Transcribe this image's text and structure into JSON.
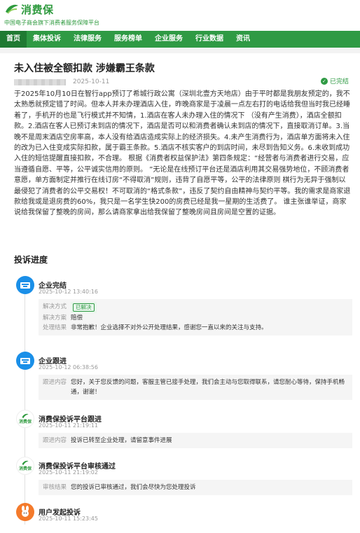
{
  "header": {
    "brand": "消费保",
    "tagline": "中国电子商会旗下消费者服务保障平台"
  },
  "nav": {
    "items": [
      "首页",
      "集体投诉",
      "法律服务",
      "服务榜单",
      "企业服务",
      "行业数据",
      "资讯"
    ]
  },
  "article": {
    "title": "未入住被全额扣款 涉嫌霸王条款",
    "date": "2025-10-11",
    "status": "已完结",
    "body": "于2025年10月10日在智行app预订了希城行政公寓（深圳北壹方天地店）由于平时都是我朋友预定的，我不太熟悉就预定错了时间。但本人并未办理酒店入住，昨晚商家是于凌晨一点左右打的电话给我但当时我已经睡着了，手机开的也是飞行模式并不知情，1.酒店在客人未办理入住的情况下 （没有产生消费），酒店全额扣款。2.酒店在客人已预订未到店的情况下，酒店是否可以和消费者确认未到店的情况下，直接取消订单。3.当晚不是周末酒店空房率高，本人没有给酒店造成实际上的经济损失。4.未产生消费行为，酒店单方面将未入住的改为已入住变成实际扣款，属于霸王条款。5.酒店不核实客户的到店时间，未尽到告知义务。6.未收到成功入住的短信提醒直接扣款，不合理。 根据《消费者权益保护法》第四条规定：“经营者与消费者进行交易，应当遵循自愿、平等，公平诚实信用的原则。 ”无论是在线预订平台还是酒店利用其交易强势地位，不顾消费者意愿，单方面制定并推行在线订房“不得取消”规则，违背了自愿平等，公平的法律原则 棋行为无异于强制以最侵犯了消费者的公平交易权！不可取消的“格式条款”，违反了契约自由精神与契约平等。我的需求是商家退款给我或是退房费的60%，我只是一名学生快200的房费已经是我一星期的生活费了。 谁主张谁举证，商家说给我保留了整晚的房间，那么请商家拿出给我保留了整晚房间且房间是空置的证据。"
  },
  "progress": {
    "title": "投诉进度",
    "steps": [
      {
        "name": "企业完结",
        "time": "2025-10-12 13:40:16",
        "avatar": "company-icon",
        "rows": [
          {
            "k": "解决方式",
            "v": "已解决"
          },
          {
            "k": "解决方案",
            "v": "赔偿"
          },
          {
            "k": "处理结果",
            "v": "非常抱歉！企业选择不对外公开处理结果，感谢您一直以来的关注与支持。"
          }
        ]
      },
      {
        "name": "企业跟进",
        "time": "2025-10-12 06:38:56",
        "avatar": "company-icon",
        "rows": [
          {
            "k": "跟进内容",
            "v": "您好，关于您反馈的问题，客服主管已接手处理，我们会主动与您取得联系，请您耐心等待，保持手机畅通，谢谢！"
          }
        ]
      },
      {
        "name": "消费保投诉平台跟进",
        "time": "2025-10-11 21:19:11",
        "avatar": "platform-logo",
        "rows": [
          {
            "k": "跟进内容",
            "v": "投诉已转至企业处理，请留意事件进展"
          }
        ]
      },
      {
        "name": "消费保投诉平台审核通过",
        "time": "2025-10-11 21:19:02",
        "avatar": "platform-logo",
        "rows": [
          {
            "k": "审核结果",
            "v": "您的投诉已审核通过，我们会尽快为您处理投诉"
          }
        ]
      },
      {
        "name": "用户发起投诉",
        "time": "2025-10-11 15:23:45",
        "avatar": "user-avatar",
        "rows": []
      }
    ]
  },
  "colors": {
    "brand": "#2f9a44",
    "company": "#1a8fe8",
    "user": "#f47a2b"
  }
}
